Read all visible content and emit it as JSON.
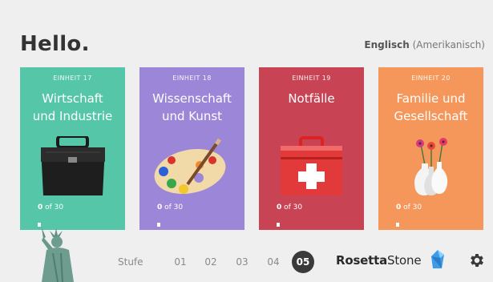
{
  "header": {
    "greeting": "Hello.",
    "language_main": "Englisch",
    "language_variant": "(Amerikanisch)"
  },
  "units": [
    {
      "unit_label": "EINHEIT 17",
      "title_line1": "Wirtschaft",
      "title_line2": "und Industrie",
      "progress_done": "0",
      "progress_rest": " of 30",
      "color": "#55c6a8",
      "icon": "briefcase-icon"
    },
    {
      "unit_label": "EINHEIT 18",
      "title_line1": "Wissenschaft",
      "title_line2": "und Kunst",
      "progress_done": "0",
      "progress_rest": " of 30",
      "color": "#9c86d8",
      "icon": "paint-palette-icon"
    },
    {
      "unit_label": "EINHEIT 19",
      "title_line1": "Notfälle",
      "title_line2": "",
      "progress_done": "0",
      "progress_rest": " of 30",
      "color": "#c84454",
      "icon": "first-aid-kit-icon"
    },
    {
      "unit_label": "EINHEIT 20",
      "title_line1": "Familie und",
      "title_line2": "Gesellschaft",
      "progress_done": "0",
      "progress_rest": " of 30",
      "color": "#f5975a",
      "icon": "flower-vases-icon"
    }
  ],
  "footer": {
    "stufe_label": "Stufe",
    "levels": [
      "01",
      "02",
      "03",
      "04",
      "05"
    ],
    "active_level": "05",
    "brand_part1": "Rosetta",
    "brand_part2": "Stone",
    "settings_icon": "gear-icon",
    "decoration_icon": "statue-of-liberty-icon"
  }
}
